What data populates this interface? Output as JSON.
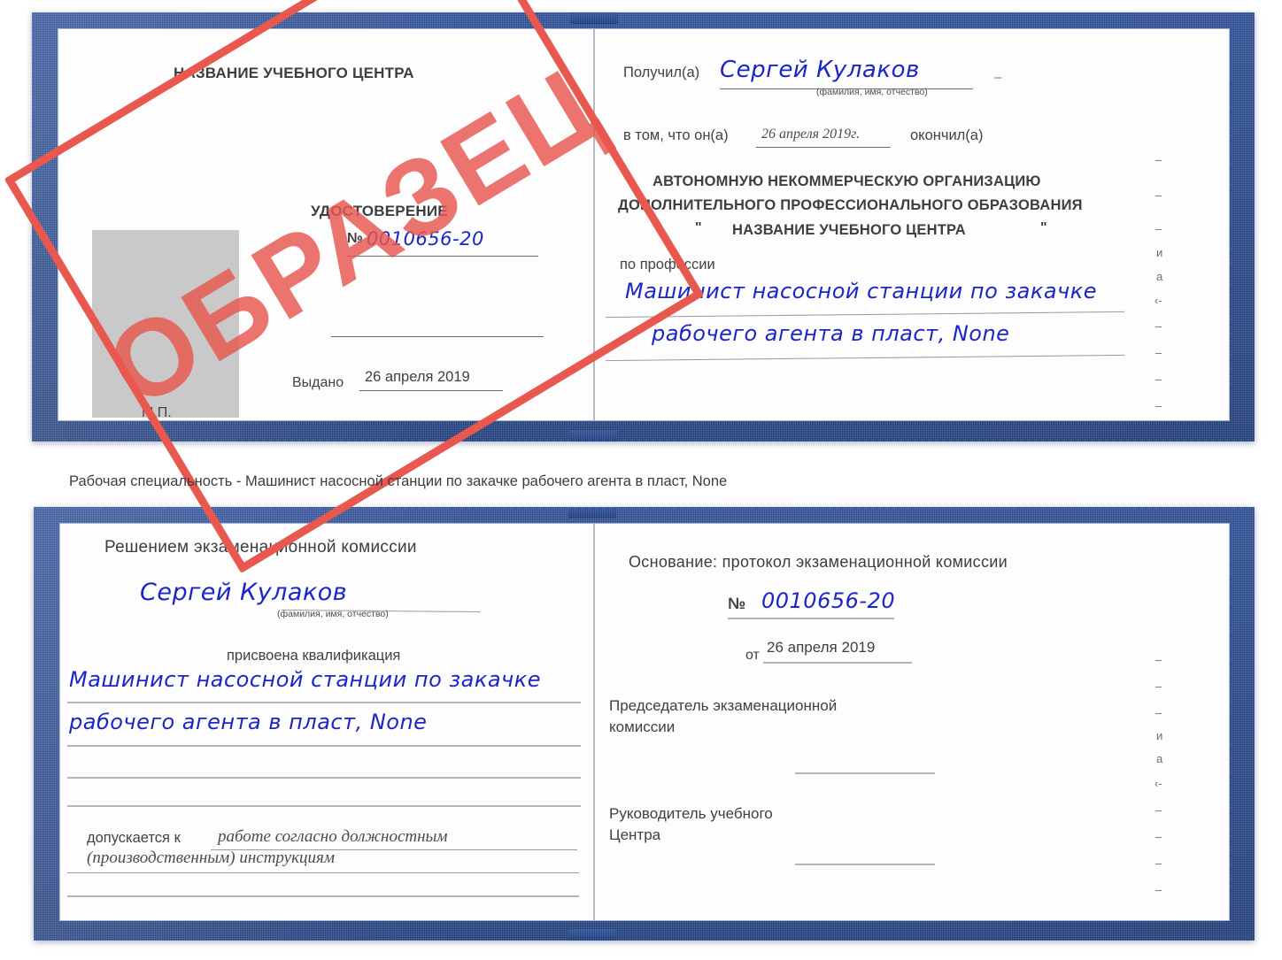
{
  "document": {
    "type": "certificate-booklet-preview",
    "stamp_label": "ОБРАЗЕЦ",
    "accent_blue": "#2f539f",
    "stamp_red": "#e8584f",
    "handwriting_blue": "#1a26c8",
    "photo_placeholder_color": "#c9c9c9"
  },
  "caption": {
    "text": "Рабочая специальность - Машинист насосной станции по закачке рабочего агента в пласт, None"
  },
  "certificate_top": {
    "left_page": {
      "org_title": "НАЗВАНИЕ УЧЕБНОГО ЦЕНТРА",
      "doc_title": "УДОСТОВЕРЕНИЕ",
      "number_label": "№",
      "number_value": "0010656-20",
      "issued_label": "Выдано",
      "issued_value": "26 апреля 2019",
      "seal_label": "М.П."
    },
    "right_page": {
      "received_label": "Получил(а)",
      "received_value": "Сергей Кулаков",
      "fio_hint": "(фамилия, имя, отчество)",
      "in_that_label": "в том, что он(а)",
      "completion_date": "26 апреля 2019г.",
      "finished_label": "окончил(а)",
      "org_line1": "АВТОНОМНУЮ НЕКОММЕРЧЕСКУЮ ОРГАНИЗАЦИЮ",
      "org_line2": "ДОПОЛНИТЕЛЬНОГО ПРОФЕССИОНАЛЬНОГО ОБРАЗОВАНИЯ",
      "org_quote_open": "\"",
      "org_line3": "НАЗВАНИЕ УЧЕБНОГО ЦЕНТРА",
      "org_quote_close": "\"",
      "profession_label": "по профессии",
      "profession_line1": "Машинист насосной станции по закачке",
      "profession_line2": "рабочего агента в пласт, None",
      "edge_glyphs": [
        "–",
        "–",
        "–",
        "и",
        "а",
        "‹-",
        "–",
        "–",
        "–",
        "–"
      ]
    }
  },
  "certificate_bottom": {
    "left_page": {
      "heading": "Решением экзаменационной комиссии",
      "name_value": "Сергей Кулаков",
      "fio_hint": "(фамилия, имя, отчество)",
      "qualification_label": "присвоена квалификация",
      "qualification_line1": "Машинист насосной станции по закачке",
      "qualification_line2": "рабочего агента в пласт, None",
      "admitted_label": "допускается к",
      "admitted_line1": "работе согласно должностным",
      "admitted_line2": "(производственным) инструкциям"
    },
    "right_page": {
      "basis_label": "Основание: протокол экзаменационной комиссии",
      "number_label": "№",
      "number_value": "0010656-20",
      "date_label": "от",
      "date_value": "26 апреля 2019",
      "chair_line1": "Председатель экзаменационной",
      "chair_line2": "комиссии",
      "head_line1": "Руководитель учебного",
      "head_line2": "Центра",
      "edge_glyphs": [
        "–",
        "–",
        "–",
        "и",
        "а",
        "‹-",
        "–",
        "–",
        "–",
        "–"
      ]
    }
  }
}
